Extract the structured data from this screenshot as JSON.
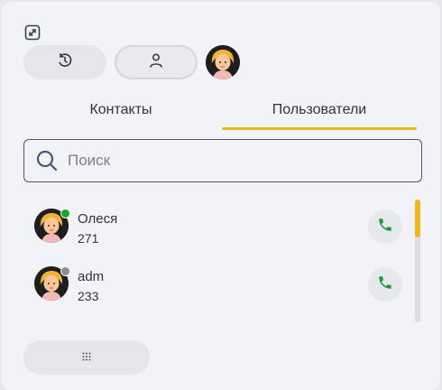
{
  "toolbar": {
    "expand_icon": "expand-icon",
    "history_icon": "history-icon",
    "profile_icon": "person-icon"
  },
  "tabs": [
    {
      "label": "Контакты",
      "active": false
    },
    {
      "label": "Пользователи",
      "active": true
    }
  ],
  "search": {
    "placeholder": "Поиск",
    "value": ""
  },
  "users": [
    {
      "name": "Олеся",
      "extension": "271",
      "status": "online",
      "status_color": "#1aa628"
    },
    {
      "name": "adm",
      "extension": "233",
      "status": "offline",
      "status_color": "#8a8d94"
    }
  ],
  "colors": {
    "accent": "#f0b51a",
    "call_icon": "#1b9a3a",
    "search_border": "#4d5478"
  },
  "footer": {
    "dialpad_icon": "dialpad-icon"
  }
}
